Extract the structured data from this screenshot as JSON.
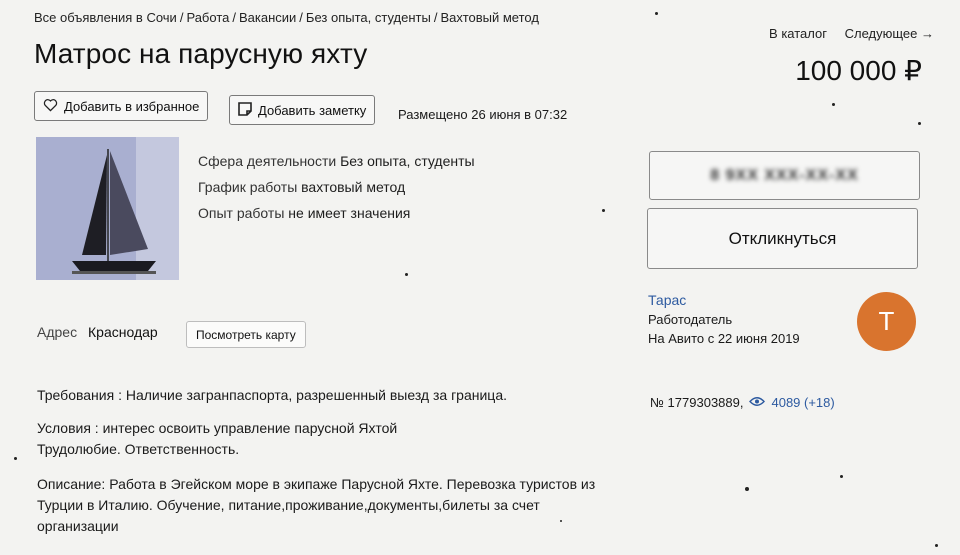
{
  "breadcrumb": [
    "Все объявления в Сочи",
    "Работа",
    "Вакансии",
    "Без опыта, студенты",
    "Вахтовый метод"
  ],
  "breadcrumb_sep": "/",
  "topnav": {
    "catalog": "В каталог",
    "next": "Следующее →"
  },
  "listing": {
    "title": "Матрос на парусную яхту",
    "price": "100 000 ₽",
    "posted": "Размещено 26 июня в 07:32",
    "favorite_label": "Добавить в избранное",
    "note_label": "Добавить заметку",
    "facts": [
      {
        "key": "Сфера деятельности",
        "value": "Без опыта, студенты"
      },
      {
        "key": "График работы",
        "value": "вахтовый метод"
      },
      {
        "key": "Опыт работы",
        "value": "не имеет значения"
      }
    ],
    "address_label": "Адрес",
    "address_value": "Краснодар",
    "map_button": "Посмотреть карту",
    "requirements": "Требования : Наличие загранпаспорта, разрешенный выезд за граница.",
    "conditions_1": "Условия : интерес освоить управление парусной Яхтой",
    "conditions_2": "Трудолюбие. Ответственность.",
    "description_1": "Описание: Работа в Эгейском море в экипаже Парусной Яхте. Перевозка туристов из",
    "description_2": "Турции в Италию. Обучение, питание,проживание,документы,билеты за счет",
    "description_3": "организации"
  },
  "contact": {
    "phone_masked": "8 9XX XXX-XX-XX",
    "reply_label": "Откликнуться",
    "seller_name": "Тарас",
    "seller_role": "Работодатель",
    "seller_since": "На Авито с 22 июня 2019",
    "avatar_letter": "Т",
    "avatar_color": "#d9742e"
  },
  "stats": {
    "ad_number": "№ 1779303889,",
    "views": "4089 (+18)"
  }
}
